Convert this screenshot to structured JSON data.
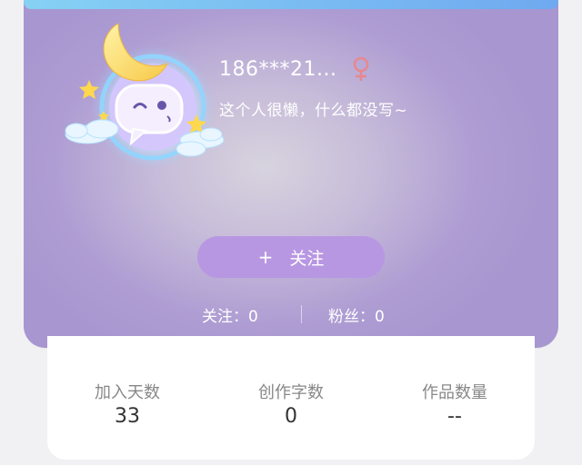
{
  "profile": {
    "username": "186***21...",
    "bio": "这个人很懒，什么都没写~",
    "gender_icon": "female-icon",
    "gender_color": "#e8878f",
    "avatar_icon": "chat-bubble-moon-avatar"
  },
  "follow_button": {
    "plus": "+",
    "label": "关注"
  },
  "social_stats": {
    "following": "关注：0",
    "fans": "粉丝：0"
  },
  "info": [
    {
      "label": "加入天数",
      "value": "33"
    },
    {
      "label": "创作字数",
      "value": "0"
    },
    {
      "label": "作品数量",
      "value": "--"
    }
  ],
  "colors": {
    "card_purple": "#a896d0",
    "button_purple": "#b897e2",
    "top_strip": "#6fa9f0"
  }
}
